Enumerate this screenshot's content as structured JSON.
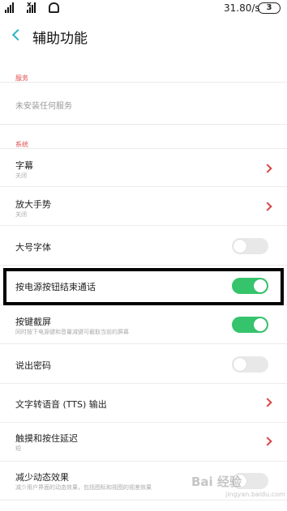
{
  "status_bar": {
    "speed": "31.80/s",
    "battery": "3"
  },
  "nav": {
    "title": "辅助功能"
  },
  "sections": {
    "services": "服务",
    "system": "系统"
  },
  "services_empty": "未安装任何服务",
  "rows": [
    {
      "label": "字幕",
      "sub": "关闭",
      "control": "chevron"
    },
    {
      "label": "放大手势",
      "sub": "关闭",
      "control": "chevron"
    },
    {
      "label": "大号字体",
      "control": "toggle",
      "state": "off"
    },
    {
      "label": "按电源按钮结束通话",
      "control": "toggle",
      "state": "on"
    },
    {
      "label": "按键截屏",
      "sub": "同时按下电源键和音量减键可截取当前的屏幕",
      "control": "toggle",
      "state": "on"
    },
    {
      "label": "说出密码",
      "control": "toggle",
      "state": "off"
    },
    {
      "label": "文字转语音 (TTS) 输出",
      "control": "chevron"
    },
    {
      "label": "触摸和按住延迟",
      "sub": "短",
      "control": "chevron"
    },
    {
      "label": "减少动态效果",
      "sub": "减少用户界面的动态效果，包括图标和视图的视差效果",
      "control": "toggle",
      "state": "off"
    }
  ],
  "watermark": {
    "text": "Bai 经验",
    "sub": "jingyan.baidu.com"
  },
  "colors": {
    "accent": "#29b4c4",
    "toggle_on": "#35c46b",
    "section": "#e04a4a",
    "highlight": "#000000"
  }
}
